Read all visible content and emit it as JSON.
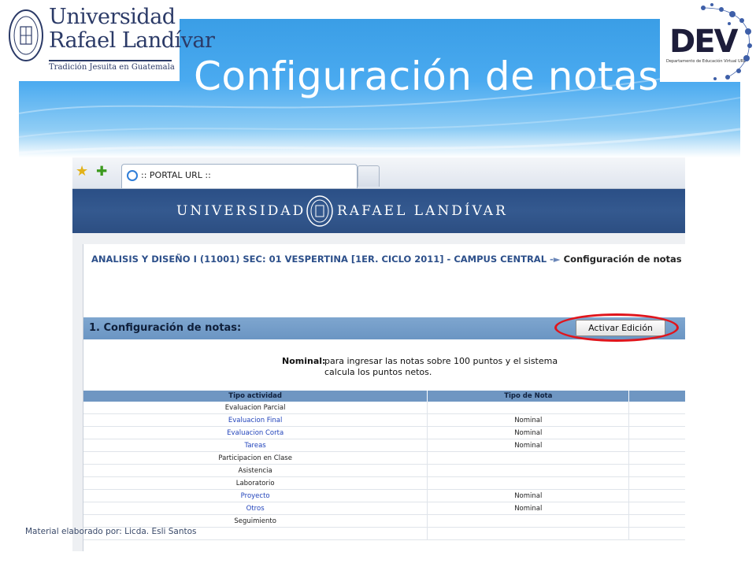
{
  "slide": {
    "title": "Configuración de notas",
    "footer": "Material elaborado por: Licda. Esli Santos"
  },
  "logos": {
    "university_line1": "Universidad",
    "university_line2": "Rafael Landívar",
    "university_tagline": "Tradición Jesuita en Guatemala",
    "dev_text": "DEV",
    "dev_subtitle": "Departamento de Educación Virtual URL"
  },
  "browser": {
    "tab_title": ":: PORTAL URL ::",
    "banner_left": "UNIVERSIDAD",
    "banner_right": "RAFAEL LANDÍVAR"
  },
  "breadcrumb": {
    "course": "ANALISIS Y DISEÑO I (11001) SEC: 01 VESPERTINA [1ER. CICLO 2011] - CAMPUS CENTRAL",
    "separator": " -► ",
    "page": "Configuración de notas"
  },
  "section": {
    "title": "1. Configuración de notas:",
    "edit_button": "Activar Edición"
  },
  "nominal": {
    "label": "Nominal:",
    "description": "para ingresar las notas sobre 100 puntos y el sistema calcula los puntos netos."
  },
  "table": {
    "headers": [
      "Tipo actividad",
      "Tipo de Nota",
      ""
    ],
    "rows": [
      {
        "activity": "Evaluacion Parcial",
        "note_type": "",
        "link": false
      },
      {
        "activity": "Evaluacion Final",
        "note_type": "Nominal",
        "link": true
      },
      {
        "activity": "Evaluacion Corta",
        "note_type": "Nominal",
        "link": true
      },
      {
        "activity": "Tareas",
        "note_type": "Nominal",
        "link": true
      },
      {
        "activity": "Participacion en Clase",
        "note_type": "",
        "link": false
      },
      {
        "activity": "Asistencia",
        "note_type": "",
        "link": false
      },
      {
        "activity": "Laboratorio",
        "note_type": "",
        "link": false
      },
      {
        "activity": "Proyecto",
        "note_type": "Nominal",
        "link": true
      },
      {
        "activity": "Otros",
        "note_type": "Nominal",
        "link": true
      },
      {
        "activity": "Seguimiento",
        "note_type": "",
        "link": false
      },
      {
        "activity": "",
        "note_type": "",
        "link": false
      }
    ]
  },
  "colors": {
    "accent_blue": "#3a9ee6",
    "banner_blue": "#2b4f86",
    "highlight_red": "#e0151c",
    "link_blue": "#2244bb"
  }
}
